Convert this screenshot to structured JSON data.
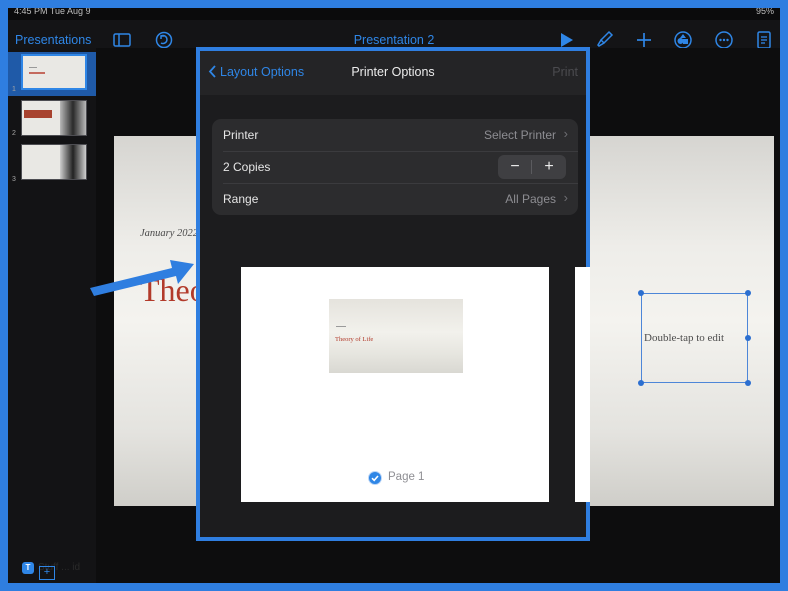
{
  "status": {
    "time": "4:45 PM  Tue Aug 9",
    "battery": "95%"
  },
  "toolbar": {
    "back_label": "Presentations",
    "title": "Presentation 2",
    "icons": [
      "sidebar-icon",
      "undo-icon",
      "play-icon",
      "brush-icon",
      "add-icon",
      "shapes-icon",
      "more-icon",
      "document-icon"
    ]
  },
  "navigator": {
    "slides": [
      {
        "number": "1",
        "selected": true
      },
      {
        "number": "2",
        "selected": false
      },
      {
        "number": "3",
        "selected": false
      }
    ]
  },
  "slide": {
    "date": "January 2022",
    "title": "Theory of Life",
    "textbox": "Double-tap to edit"
  },
  "printer_options": {
    "back_label": "Layout Options",
    "title": "Printer Options",
    "print_label": "Print",
    "printer_label": "Printer",
    "printer_value": "Select Printer",
    "copies_label": "2 Copies",
    "stepper_minus": "−",
    "stepper_plus": "+",
    "range_label": "Range",
    "range_value": "All Pages",
    "preview_slide_title": "Theory of Life",
    "page_label": "Page 1"
  },
  "colors": {
    "accent": "#2f86e6",
    "annotation": "#2f7ee0",
    "slide_title": "#b23a2a"
  },
  "watermark": {
    "text": "Stuff ... id"
  }
}
